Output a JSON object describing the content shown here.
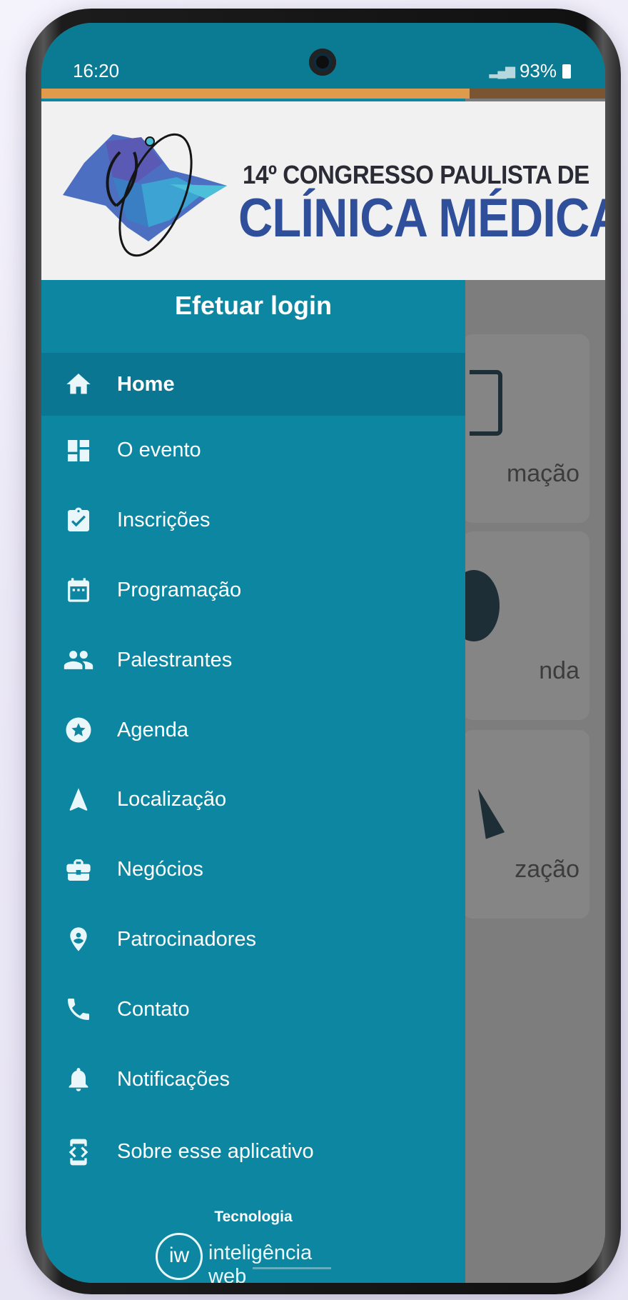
{
  "status_bar": {
    "time": "16:20",
    "battery": "93%"
  },
  "banner": {
    "line1": "14º CONGRESSO PAULISTA DE",
    "line2": "CLÍNICA MÉDICA"
  },
  "drawer": {
    "login_label": "Efetuar login",
    "items": [
      {
        "label": "Home",
        "icon": "home-icon",
        "active": true
      },
      {
        "label": "O evento",
        "icon": "dashboard-icon"
      },
      {
        "label": "Inscrições",
        "icon": "clipboard-check-icon"
      },
      {
        "label": "Programação",
        "icon": "calendar-icon"
      },
      {
        "label": "Palestrantes",
        "icon": "people-icon"
      },
      {
        "label": "Agenda",
        "icon": "star-circle-icon"
      },
      {
        "label": "Localização",
        "icon": "navigation-icon"
      },
      {
        "label": "Negócios",
        "icon": "briefcase-icon"
      },
      {
        "label": "Patrocinadores",
        "icon": "map-pin-icon"
      },
      {
        "label": "Contato",
        "icon": "phone-icon"
      },
      {
        "label": "Notificações",
        "icon": "bell-icon"
      },
      {
        "label": "Sobre esse aplicativo",
        "icon": "developer-mode-icon"
      }
    ],
    "footer": {
      "tecnologia": "Tecnologia",
      "brand_mark": "iw",
      "brand_name": "inteligência web"
    }
  },
  "background_cards": [
    {
      "label": "mação"
    },
    {
      "label": "nda"
    },
    {
      "label": "zação"
    }
  ],
  "colors": {
    "drawer": "#0c86a1",
    "drawer_active": "#0b7691",
    "status_bar": "#0b7a93",
    "accent_orange": "#e09a4c",
    "title_blue": "#2f4f9b"
  }
}
